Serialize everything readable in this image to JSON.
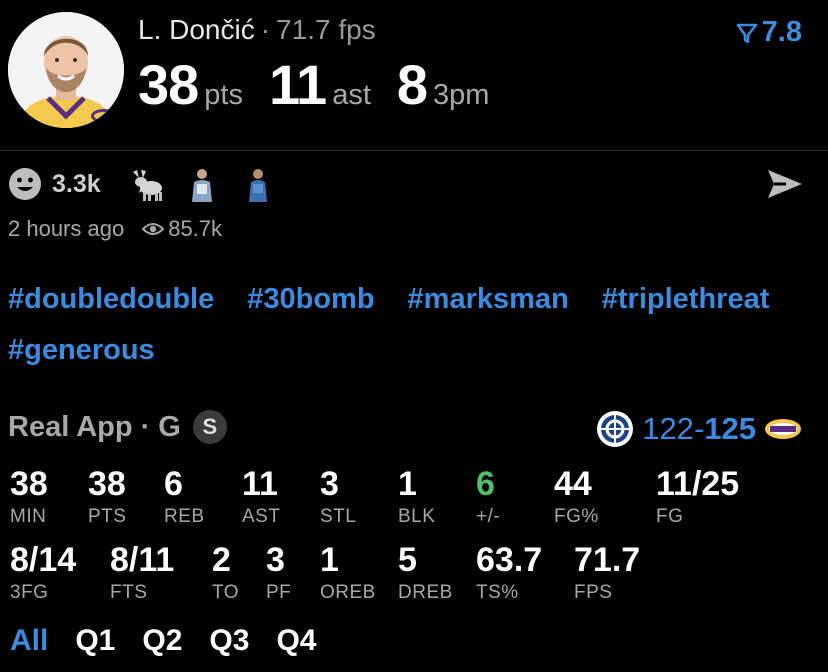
{
  "header": {
    "player_name": "L. Dončić",
    "separator": "·",
    "fps_text": "71.7 fps",
    "fps_rating": "7.8",
    "stats": [
      {
        "value": "38",
        "unit": "pts"
      },
      {
        "value": "11",
        "unit": "ast"
      },
      {
        "value": "8",
        "unit": "3pm"
      }
    ]
  },
  "reactions": {
    "count": "3.3k",
    "icons": [
      "smiley-icon",
      "goat-icon",
      "player-figure-icon",
      "player-figure-icon"
    ]
  },
  "meta": {
    "time_ago": "2 hours ago",
    "views": "85.7k"
  },
  "tags": [
    "#doubledouble",
    "#30bomb",
    "#marksman",
    "#triplethreat",
    "#generous"
  ],
  "source": {
    "name": "Real App",
    "dot": "·",
    "grade": "G",
    "badge": "S"
  },
  "score": {
    "away": "122",
    "dash": "-",
    "home": "125"
  },
  "stats_grid": {
    "row1": [
      {
        "value": "38",
        "label": "MIN"
      },
      {
        "value": "38",
        "label": "PTS"
      },
      {
        "value": "6",
        "label": "REB"
      },
      {
        "value": "11",
        "label": "AST"
      },
      {
        "value": "3",
        "label": "STL"
      },
      {
        "value": "1",
        "label": "BLK"
      },
      {
        "value": "6",
        "label": "+/-"
      },
      {
        "value": "44",
        "label": "FG%"
      },
      {
        "value": "11/25",
        "label": "FG"
      }
    ],
    "row2": [
      {
        "value": "8/14",
        "label": "3FG"
      },
      {
        "value": "8/11",
        "label": "FTS"
      },
      {
        "value": "2",
        "label": "TO"
      },
      {
        "value": "3",
        "label": "PF"
      },
      {
        "value": "1",
        "label": "OREB"
      },
      {
        "value": "5",
        "label": "DREB"
      },
      {
        "value": "63.7",
        "label": "TS%"
      },
      {
        "value": "71.7",
        "label": "FPS"
      }
    ]
  },
  "quarters": [
    "All",
    "Q1",
    "Q2",
    "Q3",
    "Q4"
  ],
  "colors": {
    "accent": "#3b8be0",
    "positive": "#4fbf6a",
    "muted": "#a8a8a8",
    "background": "#000000"
  }
}
